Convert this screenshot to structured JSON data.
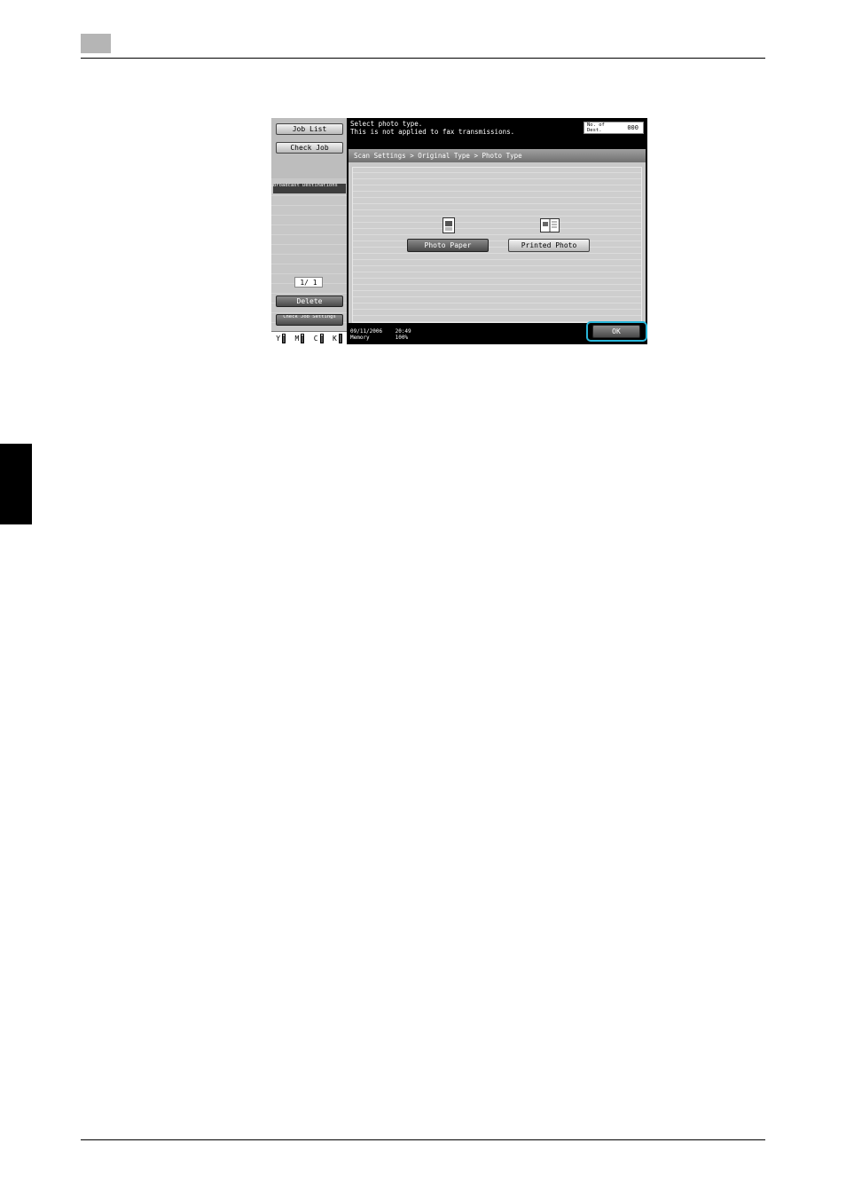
{
  "panel": {
    "sidebar": {
      "job_list_label": "Job List",
      "check_job_label": "Check Job",
      "broadcast_label": "Broadcast Destinations",
      "page_indicator": "1/  1",
      "delete_label": "Delete",
      "check_job_settings_label": "Check Job Settings",
      "toner": [
        {
          "label": "Y",
          "level": 0.8
        },
        {
          "label": "M",
          "level": 0.8
        },
        {
          "label": "C",
          "level": 0.8
        },
        {
          "label": "K",
          "level": 0.9
        }
      ]
    },
    "message": {
      "line1": "Select photo type.",
      "line2": "This is not applied to fax transmissions."
    },
    "destinations": {
      "label": "No. of Dest.",
      "value": "000"
    },
    "breadcrumb": "Scan Settings > Original Type > Photo Type",
    "options": {
      "photo_paper_label": "Photo Paper",
      "printed_photo_label": "Printed Photo"
    },
    "status": {
      "date": "09/11/2006",
      "time": "20:49",
      "memory_label": "Memory",
      "memory_value": "100%"
    },
    "ok_label": "OK"
  },
  "colors": {
    "highlight_ring": "#29b6d9"
  }
}
